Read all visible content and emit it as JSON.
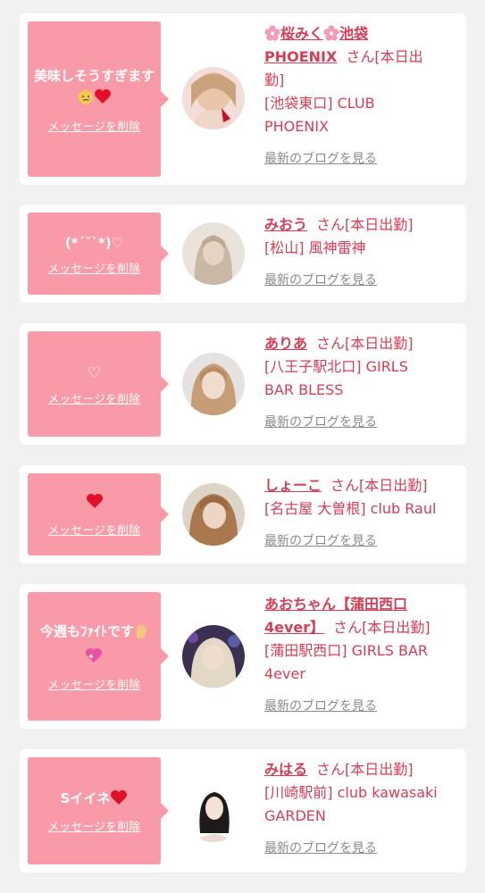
{
  "delete_label": "メッセージを削除",
  "blog_label": "最新のブログを見る",
  "colors": {
    "accent": "#d63d57",
    "bubble": "#f99aa8",
    "card": "#ffffff",
    "background": "#f1f1f1"
  },
  "messages": [
    {
      "text": "美味しそうすぎます",
      "emoji": [
        "smiling-face-with-tear-icon",
        "red-heart-icon"
      ],
      "name_pre": "桜みく",
      "name_post": "池袋",
      "name_line2": "PHOENIX",
      "suffix": "さん[本日出",
      "suffix2": "勤]",
      "store_lines": [
        "[池袋東口] CLUB",
        "PHOENIX"
      ]
    },
    {
      "text": "(*´˘`*)♡",
      "name": "みおう",
      "suffix": "さん[本日出勤]",
      "store_lines": [
        "[松山] 風神雷神"
      ]
    },
    {
      "text": "♡",
      "name": "ありあ",
      "suffix": "さん[本日出勤]",
      "store_lines": [
        "[八王子駅北口] GIRLS",
        "BAR BLESS"
      ]
    },
    {
      "text": "",
      "emoji": [
        "red-heart-icon"
      ],
      "name": "しょーこ",
      "suffix": "さん[本日出勤]",
      "store_lines": [
        "[名古屋 大曽根] club Raul"
      ]
    },
    {
      "text": "今週もﾌｧｲﾄです",
      "emoji": [
        "raised-hand-icon",
        "sparkling-heart-icon"
      ],
      "name": "あおちゃん【蒲田西口",
      "name_line2": "4ever】",
      "suffix": "さん[本日出勤]",
      "store_lines": [
        "[蒲田駅西口] GIRLS BAR",
        "4ever"
      ]
    },
    {
      "text": "Sイイネ",
      "emoji": [
        "red-heart-icon"
      ],
      "name": "みはる",
      "suffix": "さん[本日出勤]",
      "store_lines": [
        "[川崎駅前] club kawasaki",
        "GARDEN"
      ]
    }
  ]
}
